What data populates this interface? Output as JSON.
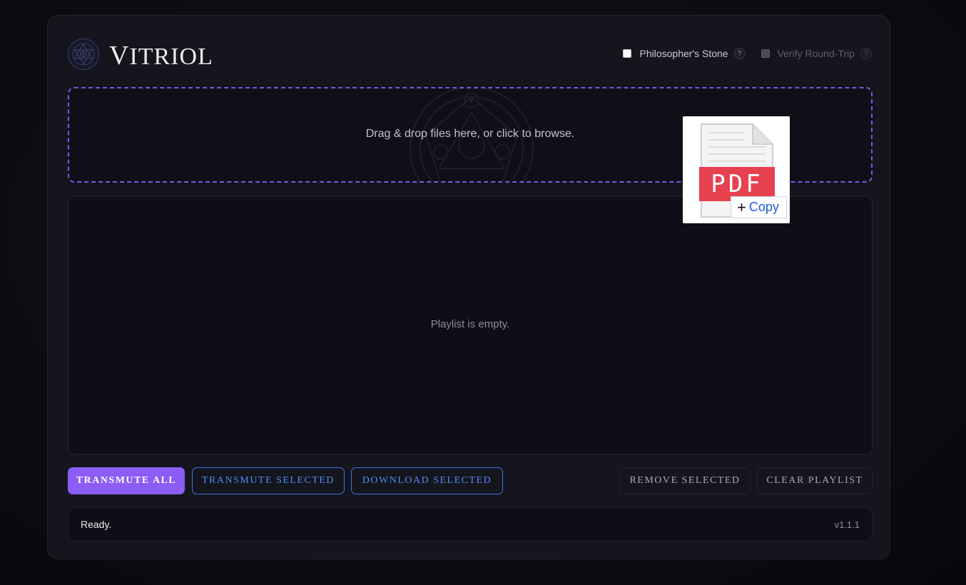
{
  "app": {
    "title": "VITRIOL",
    "title_first": "V",
    "title_rest": "ITRIOL"
  },
  "options": {
    "philosophers_stone": {
      "label": "Philosopher's Stone",
      "checked": false,
      "help": "?"
    },
    "verify_round_trip": {
      "label": "Verify Round-Trip",
      "checked": false,
      "disabled": true,
      "help": "?"
    }
  },
  "dropzone": {
    "text": "Drag & drop files here, or click to browse."
  },
  "playlist": {
    "empty_text": "Playlist is empty."
  },
  "actions": {
    "transmute_all": "TRANSMUTE ALL",
    "transmute_selected": "TRANSMUTE SELECTED",
    "download_selected": "DOWNLOAD SELECTED",
    "remove_selected": "REMOVE SELECTED",
    "clear_playlist": "CLEAR PLAYLIST"
  },
  "status": {
    "text": "Ready.",
    "version": "v1.1.1"
  },
  "drag_ghost": {
    "file_type": "PDF",
    "icon": "pdf-file-icon",
    "effect_label": "Copy",
    "effect_icon": "plus-icon"
  },
  "colors": {
    "accent": "#8b5cf6",
    "outline_blue": "#3b74e6",
    "dropzone_border": "#7f55e8",
    "pdf_red": "#e5414f"
  }
}
